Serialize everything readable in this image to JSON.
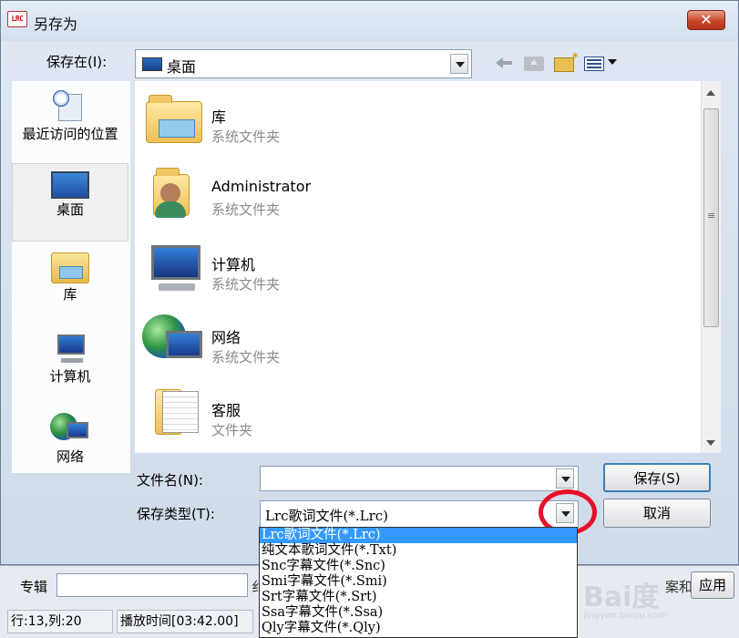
{
  "window": {
    "icon_text": "LRC",
    "title": "另存为",
    "close_label": "✕"
  },
  "location": {
    "label": "保存在(I):",
    "value": "桌面"
  },
  "toolbar": {
    "icons": [
      "back-arrow-icon",
      "up-folder-icon",
      "new-folder-icon",
      "view-menu-icon"
    ]
  },
  "places": [
    {
      "label": "最近访问的位置",
      "icon": "recent-places-icon"
    },
    {
      "label": "桌面",
      "icon": "desktop-icon",
      "selected": true
    },
    {
      "label": "库",
      "icon": "libraries-icon"
    },
    {
      "label": "计算机",
      "icon": "computer-icon"
    },
    {
      "label": "网络",
      "icon": "network-icon"
    }
  ],
  "files": [
    {
      "name": "库",
      "type": "系统文件夹",
      "icon": "library-folder-icon"
    },
    {
      "name": "Administrator",
      "type": "系统文件夹",
      "icon": "user-folder-icon"
    },
    {
      "name": "计算机",
      "type": "系统文件夹",
      "icon": "computer-icon"
    },
    {
      "name": "网络",
      "type": "系统文件夹",
      "icon": "network-icon"
    },
    {
      "name": "客服",
      "type": "文件夹",
      "icon": "folder-icon"
    }
  ],
  "filename": {
    "label": "文件名(N):",
    "value": ""
  },
  "filetype": {
    "label": "保存类型(T):",
    "value": "Lrc歌词文件(*.Lrc)",
    "options": [
      "Lrc歌词文件(*.Lrc)",
      "纯文本歌词文件(*.Txt)",
      "Snc字幕文件(*.Snc)",
      "Smi字幕文件(*.Smi)",
      "Srt字幕文件(*.Srt)",
      "Ssa字幕文件(*.Ssa)",
      "Qly字幕文件(*.Qly)"
    ]
  },
  "buttons": {
    "save": "保存(S)",
    "cancel": "取消"
  },
  "background_app": {
    "album_label": "专辑",
    "cut_char": "纟",
    "right_fragment_1": "案和",
    "right_fragment_2": "应用",
    "status_position": "行:13,列:20",
    "status_time": "播放时间[03:42.00]"
  },
  "watermark": {
    "text": "Bai度",
    "sub": "jingyan.baidu.com"
  },
  "colors": {
    "selection": "#3399ff",
    "annotation_circle": "#e8102a",
    "close_button": "#c7452a"
  }
}
